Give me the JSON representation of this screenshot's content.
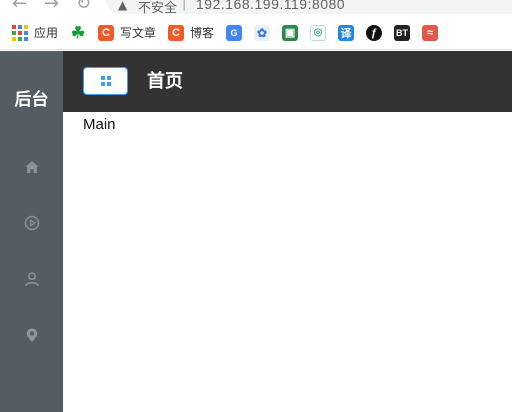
{
  "browser": {
    "security_label": "不安全",
    "url": "192.168.199.119:8080"
  },
  "bookmarks": [
    {
      "icon": "apps-grid-icon",
      "label": "应用"
    },
    {
      "icon": "clover-icon",
      "label": ""
    },
    {
      "icon": "csdn-icon",
      "label": "写文章"
    },
    {
      "icon": "csdn-icon",
      "label": "博客"
    },
    {
      "icon": "translate-icon",
      "label": ""
    },
    {
      "icon": "bird-icon",
      "label": ""
    },
    {
      "icon": "android-icon",
      "label": ""
    },
    {
      "icon": "cloud-icon",
      "label": ""
    },
    {
      "icon": "yi-icon",
      "label": ""
    },
    {
      "icon": "circle-icon",
      "label": ""
    },
    {
      "icon": "bt-icon",
      "label": ""
    },
    {
      "icon": "red-icon",
      "label": ""
    }
  ],
  "sidebar": {
    "brand": "后台",
    "items": [
      {
        "icon": "home-icon"
      },
      {
        "icon": "video-play-icon"
      },
      {
        "icon": "user-icon"
      },
      {
        "icon": "location-icon"
      }
    ]
  },
  "header": {
    "title": "首页"
  },
  "main": {
    "text": "Main"
  },
  "colors": {
    "sidebar_bg": "#545c64",
    "header_bg": "#333333",
    "accent": "#409eff"
  }
}
